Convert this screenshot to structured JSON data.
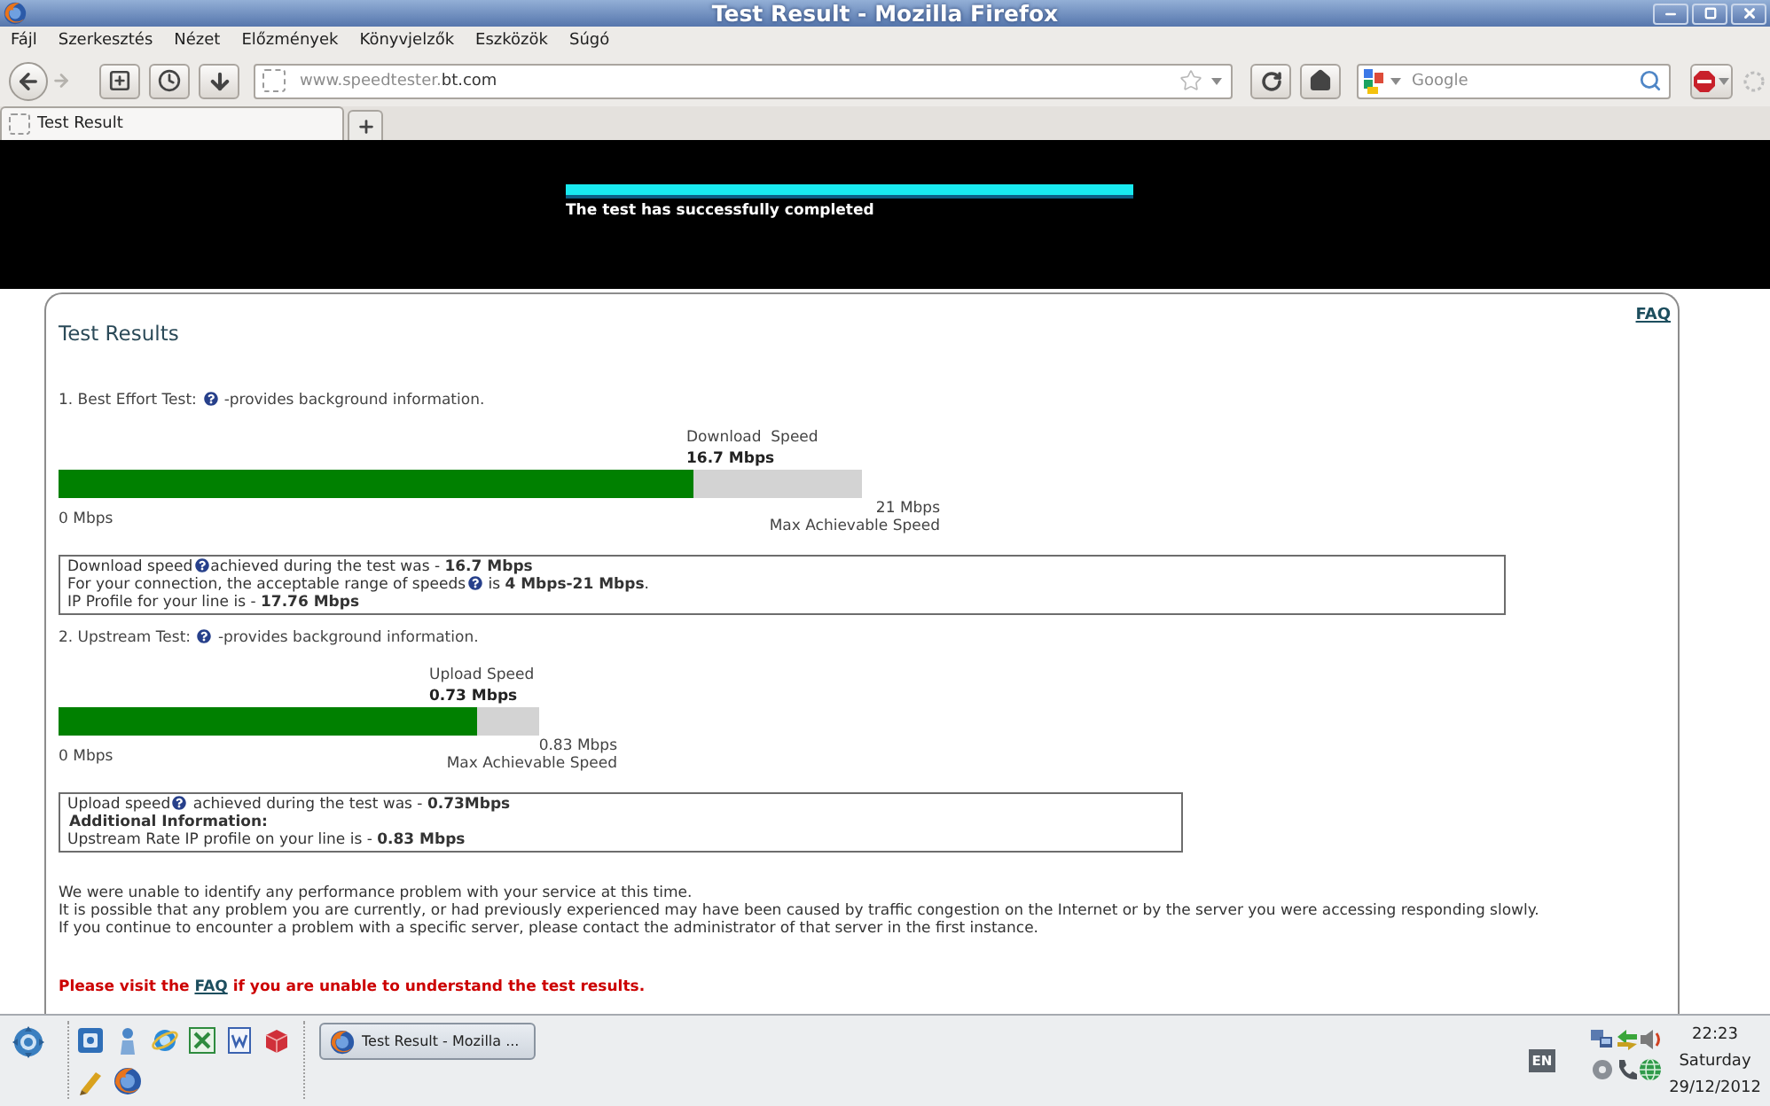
{
  "window": {
    "title": "Test Result - Mozilla Firefox"
  },
  "menu": [
    "Fájl",
    "Szerkesztés",
    "Nézet",
    "Előzmények",
    "Könyvjelzők",
    "Eszközök",
    "Súgó"
  ],
  "navigation": {
    "back": {
      "disabled": false
    },
    "forward": {
      "disabled": true
    },
    "address": {
      "host": "www.speedtester.",
      "domain": "bt.com"
    },
    "search": {
      "placeholder": "Google"
    }
  },
  "tabs": [
    {
      "label": "Test Result",
      "selected": true
    }
  ],
  "banner": {
    "progress": {
      "level": 1
    },
    "message": "The test has successfully completed"
  },
  "results": {
    "title": "Test Results",
    "faq_link": "FAQ",
    "tests": [
      {
        "kind": "download",
        "heading": "1. Best Effort Test:",
        "help": true,
        "note": "-provides background information.",
        "speed_label": "Download  Speed",
        "speed": "16.7 Mbps",
        "level": 0.79,
        "min": "0 Mbps",
        "max": "21 Mbps",
        "max_label": "Max Achievable Speed",
        "summary": [
          {
            "kind": "text",
            "text": "Download speed",
            "help": true,
            "rest": "achieved during the test was - **16.7 Mbps**"
          },
          {
            "kind": "text",
            "text": "For your connection, the acceptable range of speeds",
            "help": true,
            "rest": " is **4 Mbps-21 Mbps**."
          },
          {
            "kind": "text",
            "text": "IP Profile for your line is - **17.76 Mbps**",
            "help": false
          }
        ]
      },
      {
        "kind": "upload",
        "heading": "2. Upstream Test:",
        "help": true,
        "note": "-provides background information.",
        "speed_label": "Upload Speed",
        "speed": "0.73 Mbps",
        "level": 0.87,
        "min": "0 Mbps",
        "max": "0.83 Mbps",
        "max_label": "Max Achievable Speed",
        "summary": [
          {
            "kind": "text",
            "text": "Upload speed",
            "help": true,
            "rest": " achieved during the test was - **0.73Mbps**"
          },
          {
            "kind": "heading",
            "text": "Additional Information:",
            "help": false
          },
          {
            "kind": "text",
            "text": "Upstream Rate IP profile on your line is - **0.83 Mbps**",
            "help": false
          }
        ]
      }
    ],
    "message": [
      "We were unable to identify any performance problem with your service at this time.",
      "It is possible that any problem you are currently, or had previously experienced may have been caused by traffic congestion on the Internet or by the server you were accessing responding slowly.",
      "If you continue to encounter a problem with a specific server, please contact the administrator of that server in the first instance."
    ],
    "footer": {
      "before": "Please visit the",
      "link": "FAQ",
      "after": "if you are unable to understand the test results."
    }
  },
  "taskbar": {
    "tasks": [
      {
        "label": "Test Result - Mozilla ...",
        "selected": true
      }
    ],
    "language": "EN",
    "clock": {
      "time": "22:23",
      "day": "Saturday",
      "date": "29/12/2012"
    }
  }
}
